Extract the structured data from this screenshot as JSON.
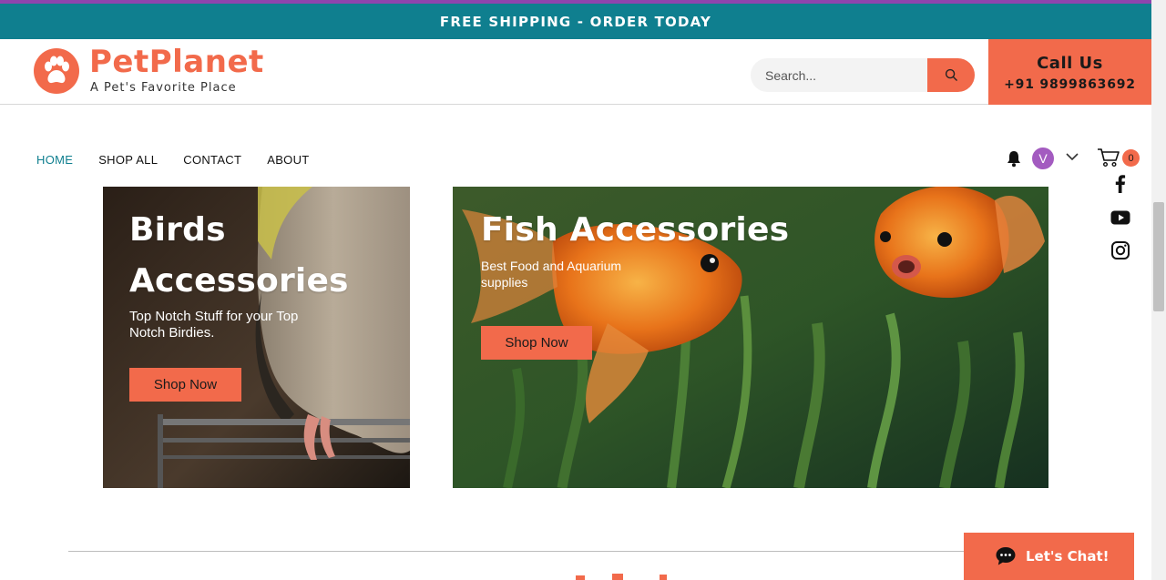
{
  "promo_bar": {
    "text": "FREE SHIPPING - ORDER TODAY"
  },
  "header": {
    "brand": "PetPlanet",
    "tagline": "A Pet's Favorite Place",
    "search_placeholder": "Search...",
    "call": {
      "title": "Call Us",
      "phone": "+91 9899863692"
    }
  },
  "nav": {
    "items": [
      "HOME",
      "SHOP ALL",
      "CONTACT",
      "ABOUT"
    ],
    "active": "HOME"
  },
  "account": {
    "avatar_letter": "V",
    "cart_count": "0"
  },
  "social": [
    "facebook-icon",
    "youtube-icon",
    "instagram-icon"
  ],
  "banners": [
    {
      "title_line1": "Birds",
      "title_line2": "Accessories",
      "subtitle_line1": "Top Notch Stuff for your Top",
      "subtitle_line2": "Notch Birdies.",
      "button": "Shop Now"
    },
    {
      "title": "Fish Accessories",
      "subtitle_line1": "Best Food and Aquarium",
      "subtitle_line2": "supplies",
      "button": "Shop Now"
    }
  ],
  "chat": {
    "label": "Let's Chat!"
  },
  "colors": {
    "accent": "#f26a4b",
    "teal": "#0f7f8f",
    "purple": "#8e44ad"
  }
}
